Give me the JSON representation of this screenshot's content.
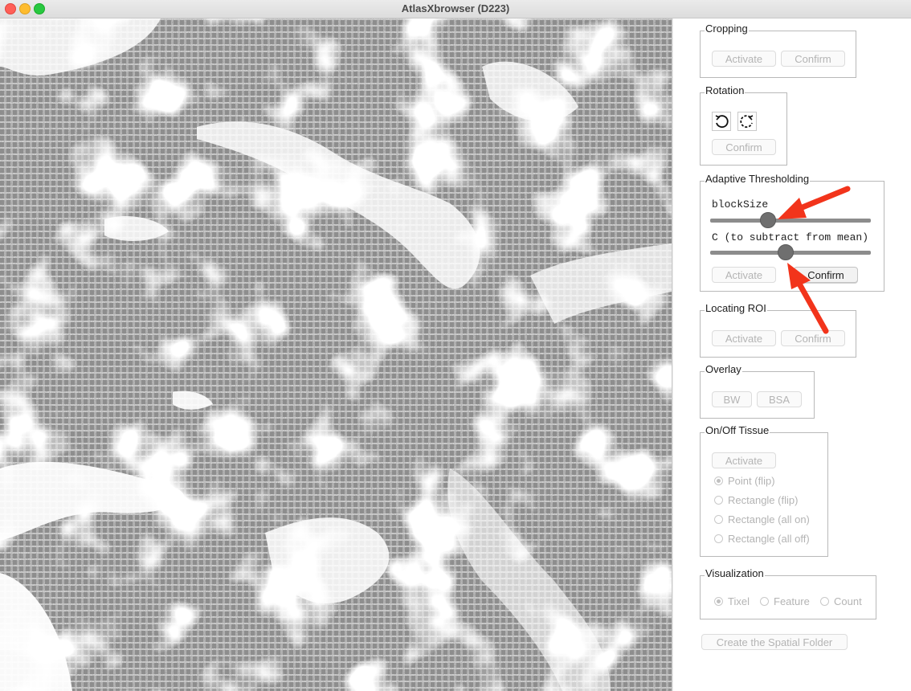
{
  "window": {
    "title": "AtlasXbrowser (D223)"
  },
  "groups": {
    "cropping": {
      "title": "Cropping",
      "activate": "Activate",
      "confirm": "Confirm"
    },
    "rotation": {
      "title": "Rotation",
      "rotate_ccw_icon": "rotate-counterclockwise-icon",
      "rotate_cw_icon": "rotate-clockwise-icon",
      "confirm": "Confirm"
    },
    "adaptive": {
      "title": "Adaptive Thresholding",
      "blocksize_label": "blockSize",
      "blocksize_value": 0.36,
      "c_label": "C (to subtract from mean)",
      "c_value": 0.47,
      "activate": "Activate",
      "confirm": "Confirm"
    },
    "roi": {
      "title": "Locating ROI",
      "activate": "Activate",
      "confirm": "Confirm"
    },
    "overlay": {
      "title": "Overlay",
      "bw": "BW",
      "bsa": "BSA"
    },
    "tissue": {
      "title": "On/Off Tissue",
      "activate": "Activate",
      "options": [
        "Point (flip)",
        "Rectangle (flip)",
        "Rectangle (all on)",
        "Rectangle (all off)"
      ],
      "selected": 0
    },
    "visualization": {
      "title": "Visualization",
      "options": [
        "Tixel",
        "Feature",
        "Count"
      ],
      "selected": 0
    }
  },
  "create_button": "Create the Spatial Folder",
  "annotation_color": "#f2341b"
}
